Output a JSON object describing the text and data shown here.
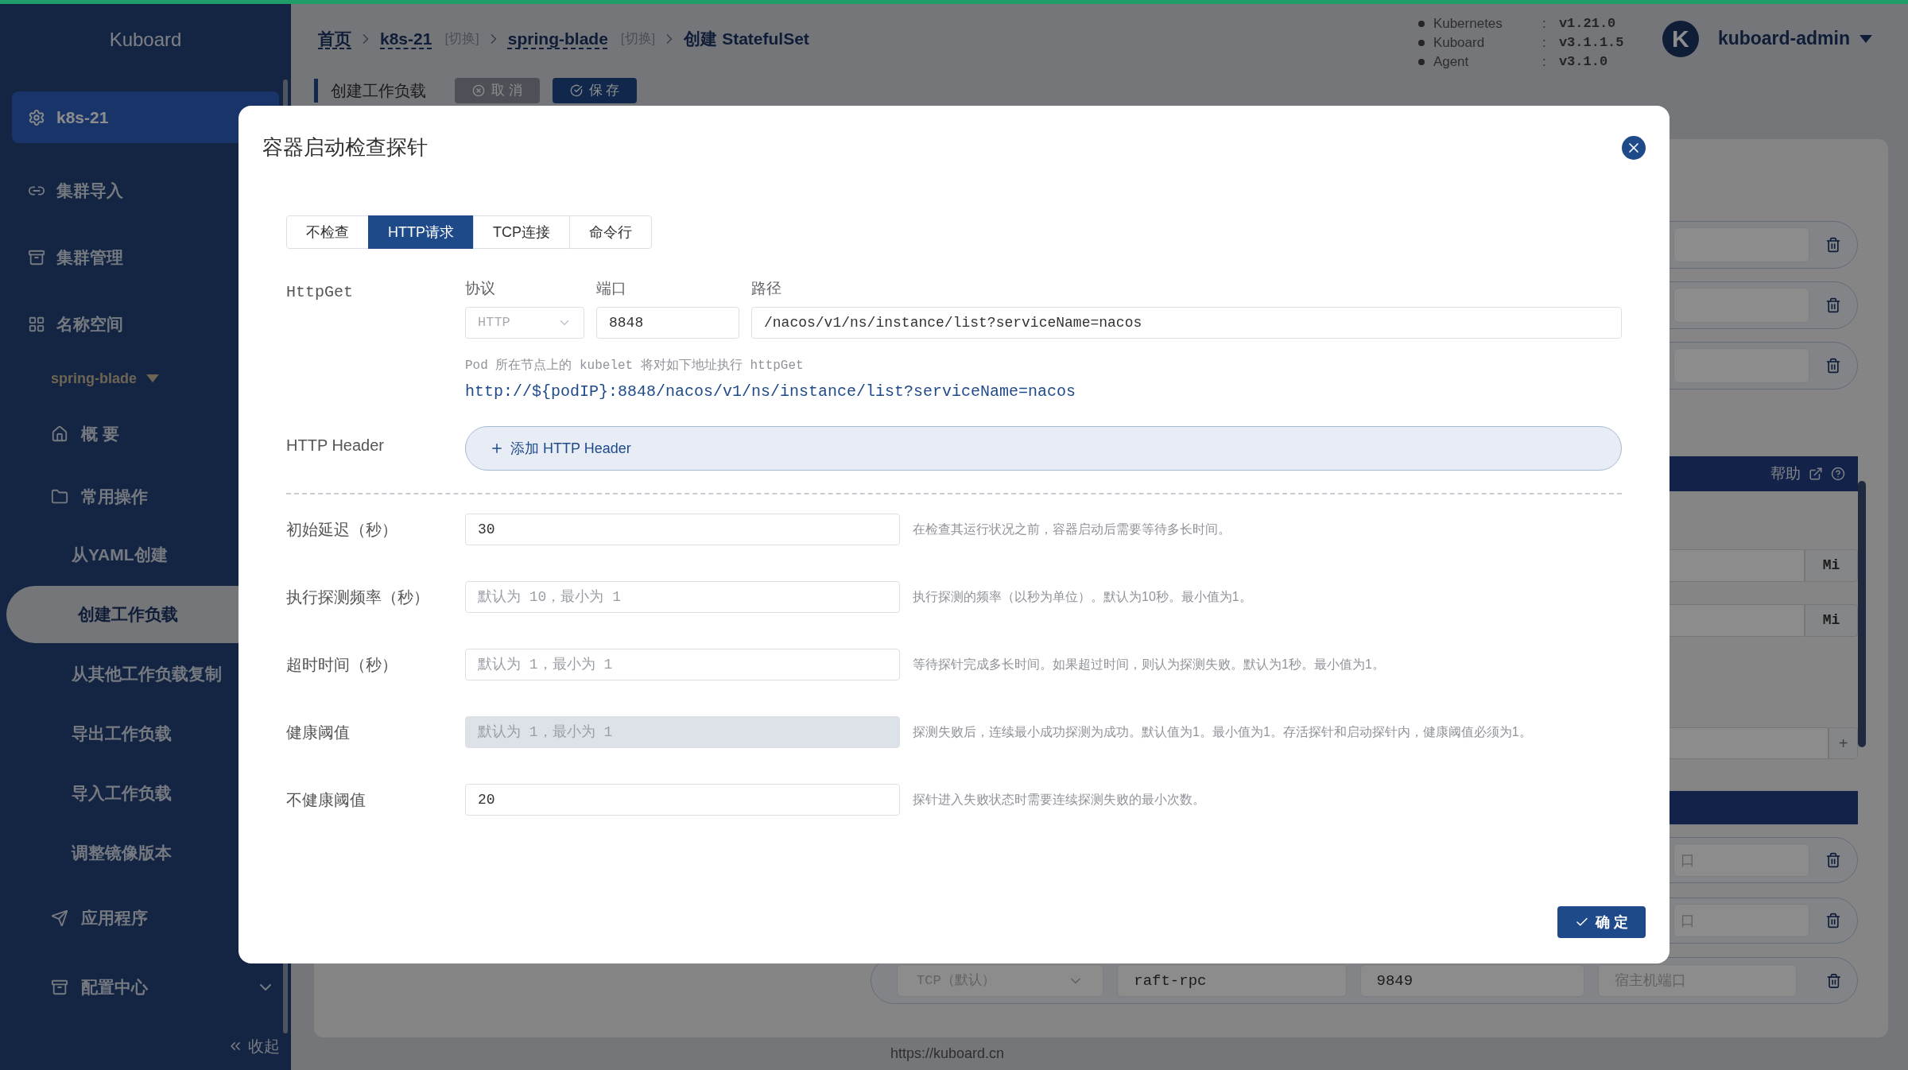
{
  "sidebar": {
    "title": "Kuboard",
    "items": [
      {
        "kind": "cluster",
        "label": "k8s-21",
        "selected": true
      },
      {
        "kind": "section",
        "label": "集群导入",
        "selected": false
      },
      {
        "kind": "section",
        "label": "集群管理",
        "selected": false
      },
      {
        "kind": "section",
        "label": "名称空间",
        "selected": false
      },
      {
        "kind": "namespace",
        "label": "spring-blade",
        "selected": false
      },
      {
        "kind": "entry",
        "label": "概 要",
        "selected": false
      },
      {
        "kind": "entry",
        "label": "常用操作",
        "selected": false
      },
      {
        "kind": "sub",
        "label": "从YAML创建",
        "selected": false
      },
      {
        "kind": "sub",
        "label": "创建工作负载",
        "selected": true
      },
      {
        "kind": "sub",
        "label": "从其他工作负载复制",
        "selected": false
      },
      {
        "kind": "sub",
        "label": "导出工作负载",
        "selected": false
      },
      {
        "kind": "sub",
        "label": "导入工作负载",
        "selected": false
      },
      {
        "kind": "sub",
        "label": "调整镜像版本",
        "selected": false
      },
      {
        "kind": "entry",
        "label": "应用程序",
        "selected": false
      },
      {
        "kind": "group",
        "label": "配置中心",
        "selected": false
      }
    ],
    "collapse": "收起"
  },
  "header": {
    "breadcrumb": [
      {
        "kind": "link",
        "label": "首页"
      },
      {
        "kind": "link",
        "label": "k8s-21"
      },
      {
        "kind": "switch",
        "label": "[切换]"
      },
      {
        "kind": "link",
        "label": "spring-blade"
      },
      {
        "kind": "switch",
        "label": "[切换]"
      },
      {
        "kind": "current",
        "label": "创建 StatefulSet"
      }
    ],
    "versions": [
      {
        "name": "Kubernetes",
        "sep": ":",
        "value": "v1.21.0"
      },
      {
        "name": "Kuboard",
        "sep": ":",
        "value": "v3.1.1.5"
      },
      {
        "name": "Agent",
        "sep": ":",
        "value": "v3.1.0"
      }
    ],
    "user": {
      "initial": "K",
      "name": "kuboard-admin"
    }
  },
  "toolbar": {
    "title": "创建工作负载",
    "buttons": [
      {
        "kind": "cancel",
        "label": "取 消"
      },
      {
        "kind": "save",
        "label": "保 存"
      }
    ]
  },
  "background_form": {
    "rows": [
      {
        "kind": "trash_row"
      },
      {
        "kind": "trash_row"
      },
      {
        "kind": "trash_row"
      },
      {
        "kind": "help_bar",
        "label": "帮助"
      },
      {
        "kind": "unit_field",
        "unit": "Mi"
      },
      {
        "kind": "unit_field",
        "unit": "Mi"
      },
      {
        "kind": "add_field",
        "label": "+"
      },
      {
        "kind": "section_bar"
      },
      {
        "kind": "port_row",
        "placeholder": "口"
      },
      {
        "kind": "port_row",
        "placeholder": "口"
      },
      {
        "kind": "port_full",
        "protocol": "TCP（默认）",
        "name": "raft-rpc",
        "port": "9849",
        "placeholder": "宿主机端口"
      }
    ]
  },
  "footer": "https://kuboard.cn",
  "dialog": {
    "title": "容器启动检查探针",
    "tabs": [
      {
        "label": "不检查",
        "selected": false
      },
      {
        "label": "HTTP请求",
        "selected": true
      },
      {
        "label": "TCP连接",
        "selected": false
      },
      {
        "label": "命令行",
        "selected": false
      }
    ],
    "http_get": {
      "label": "HttpGet",
      "protocol": {
        "label": "协议",
        "value": "HTTP",
        "disabled": true
      },
      "port": {
        "label": "端口",
        "value": "8848"
      },
      "path": {
        "label": "路径",
        "value": "/nacos/v1/ns/instance/list?serviceName=nacos"
      },
      "hint": "Pod 所在节点上的 kubelet 将对如下地址执行 httpGet",
      "url": "http://${podIP}:8848/nacos/v1/ns/instance/list?serviceName=nacos"
    },
    "http_header": {
      "label": "HTTP Header",
      "button": "添加 HTTP Header"
    },
    "fields": [
      {
        "label": "初始延迟（秒）",
        "value": "30",
        "disabled": false,
        "hint": "在检查其运行状况之前，容器启动后需要等待多长时间。"
      },
      {
        "label": "执行探测频率（秒）",
        "placeholder": "默认为 10，最小为 1",
        "disabled": false,
        "hint": "执行探测的频率（以秒为单位）。默认为10秒。最小值为1。"
      },
      {
        "label": "超时时间（秒）",
        "placeholder": "默认为 1，最小为 1",
        "disabled": false,
        "hint": "等待探针完成多长时间。如果超过时间，则认为探测失败。默认为1秒。最小值为1。"
      },
      {
        "label": "健康阈值",
        "placeholder": "默认为 1，最小为 1",
        "disabled": true,
        "hint": "探测失败后，连续最小成功探测为成功。默认值为1。最小值为1。存活探针和启动探针内，健康阈值必须为1。"
      },
      {
        "label": "不健康阈值",
        "value": "20",
        "disabled": false,
        "hint": "探针进入失败状态时需要连续探测失败的最小次数。"
      }
    ],
    "confirm": "确 定"
  }
}
